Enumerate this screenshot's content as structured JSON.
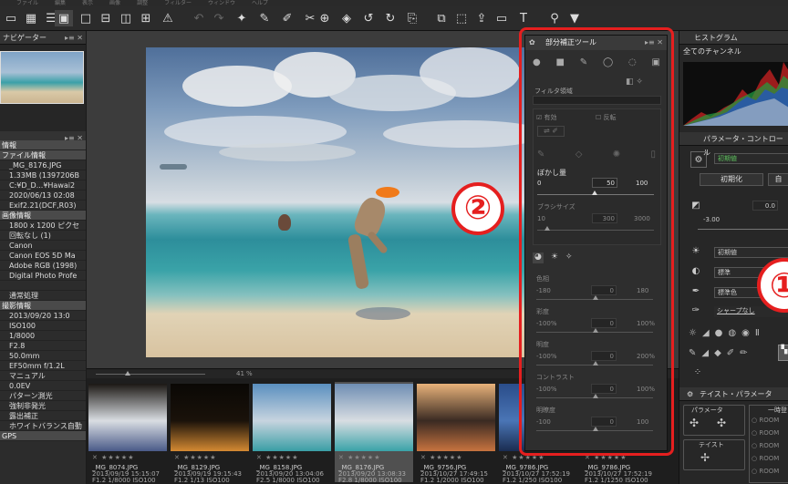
{
  "menubar": {
    "items": [
      "ファイル",
      "編集",
      "表示",
      "画像",
      "調整",
      "フィルター",
      "ウィンドウ",
      "ヘルプ"
    ]
  },
  "left": {
    "navigator_title": "ナビゲーター",
    "info_header": "情報",
    "info_rows": [
      {
        "t": "ファイル情報",
        "h": true
      },
      {
        "t": "_MG_8176.JPG"
      },
      {
        "t": "1.33MB (1397206B"
      },
      {
        "t": "C:¥D_D...¥Hawai2"
      },
      {
        "t": "2020/06/13 02:08"
      },
      {
        "t": "Exif2.21(DCF,R03)"
      },
      {
        "t": "画像情報",
        "h": true
      },
      {
        "t": "1800 x 1200 ピクセ"
      },
      {
        "t": "回転なし (1)"
      },
      {
        "t": "Canon"
      },
      {
        "t": "Canon EOS 5D Ma"
      },
      {
        "t": "Adobe RGB (1998)"
      },
      {
        "t": "Digital Photo Profe"
      },
      {
        "t": ""
      },
      {
        "t": "通常処理"
      },
      {
        "t": "撮影情報",
        "h": true
      },
      {
        "t": "2013/09/20 13:0"
      },
      {
        "t": "ISO100"
      },
      {
        "t": "1/8000"
      },
      {
        "t": "F2.8"
      },
      {
        "t": "50.0mm"
      },
      {
        "t": "EF50mm f/1.2L"
      },
      {
        "t": "マニュアル"
      },
      {
        "t": "0.0EV"
      },
      {
        "t": "パターン測光"
      },
      {
        "t": "強制非発光"
      },
      {
        "t": "露出補正"
      },
      {
        "t": "ホワイトバランス自動"
      },
      {
        "t": "GPS",
        "h": true
      }
    ],
    "side_labels": [
      "m",
      "ce"
    ]
  },
  "zoom": {
    "value": "41",
    "unit": "%"
  },
  "filmstrip": [
    {
      "name": "_MG_8074.JPG",
      "date": "2013/09/19 15:15:07",
      "exp": "F1.2 1/8000 ISO100",
      "colors": [
        "#1c1814",
        "#d9dde2",
        "#4a5a88"
      ]
    },
    {
      "name": "_MG_8129.JPG",
      "date": "2013/09/19 19:15:43",
      "exp": "F1.2 1/13 ISO100",
      "colors": [
        "#0a0805",
        "#1a120a",
        "#d48a32"
      ]
    },
    {
      "name": "_MG_8158.JPG",
      "date": "2013/09/20 13:04:06",
      "exp": "F2.5 1/8000 ISO100",
      "colors": [
        "#5a8fbf",
        "#c7d4df",
        "#3a9ea5"
      ]
    },
    {
      "name": "_MG_8176.JPG",
      "date": "2013/09/20 13:08:33",
      "exp": "F2.8 1/8000 ISO100",
      "colors": [
        "#6f8eb3",
        "#d8dde2",
        "#3aa3a8"
      ]
    },
    {
      "name": "_MG_9756.JPG",
      "date": "2013/10/27 17:49:15",
      "exp": "F1.2 1/2000 ISO100",
      "colors": [
        "#e8b27a",
        "#3a2a22",
        "#c7733f"
      ]
    },
    {
      "name": "_MG_9786.JPG",
      "date": "2013/10/27 17:52:19",
      "exp": "F1.2 1/250 ISO100",
      "colors": [
        "#2a4d8a",
        "#4a75b5",
        "#1a2c50"
      ]
    },
    {
      "name": "_MG_9786.JPG",
      "date": "2013/10/27 17:52:19",
      "exp": "F1.2 1/1250 ISO100",
      "colors": [
        "#111",
        "#333",
        "#222"
      ]
    }
  ],
  "ptool": {
    "title": "部分補正ツール",
    "filter_label": "フィルタ領域",
    "enable_label": "有効",
    "invert_label": "反転",
    "blur_label": "ぼかし量",
    "blur": {
      "min": "0",
      "value": "50",
      "max": "100"
    },
    "brush_label": "ブラシサイズ",
    "brush": {
      "min": "10",
      "value": "300",
      "max": "3000"
    },
    "adjust": [
      {
        "label": "色相",
        "min": "-180",
        "value": "0",
        "max": "180"
      },
      {
        "label": "彩度",
        "min": "-100%",
        "value": "0",
        "max": "100%"
      },
      {
        "label": "明度",
        "min": "-100%",
        "value": "0",
        "max": "200%"
      },
      {
        "label": "コントラスト",
        "min": "-100%",
        "value": "0",
        "max": "100%"
      },
      {
        "label": "明瞭度",
        "min": "-100",
        "value": "0",
        "max": "100"
      }
    ]
  },
  "right": {
    "hist_title": "ヒストグラム",
    "hist_channel": "全てのチャンネル",
    "param_title": "パラメータ・コントロール",
    "preset": "初期値",
    "init_btn": "初期化",
    "auto_btn": "自",
    "exposure_value": "0.0",
    "exposure_min": "-3.00",
    "style1": "初期値",
    "style2": "標準",
    "style3": "標準色",
    "sharp": "シャープなし",
    "taste_title": "テイスト・パラメータ",
    "param_btn": "パラメータ",
    "taste_btn": "テイスト",
    "temp_label": "一時登",
    "room": "ROOM"
  },
  "annotations": {
    "m1": "①",
    "m2": "②"
  },
  "colors": {
    "annotation_red": "#e51f1f",
    "dog_orange": "#f07a1a"
  }
}
